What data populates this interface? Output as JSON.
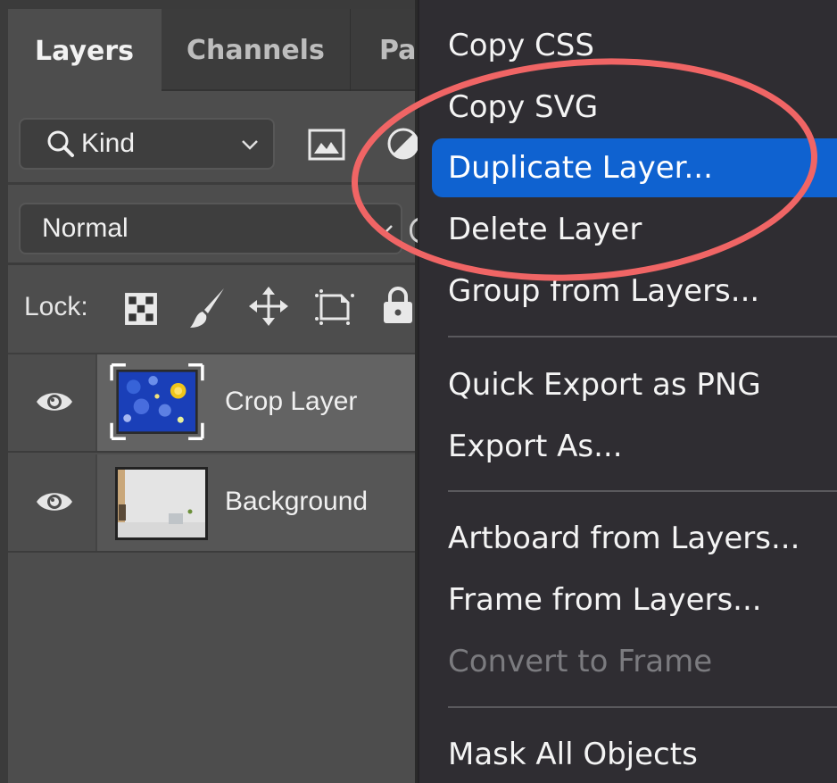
{
  "panel": {
    "tabs": [
      {
        "label": "Layers",
        "active": true
      },
      {
        "label": "Channels",
        "active": false
      },
      {
        "label": "Paths",
        "active": false,
        "visible_text": "Pa"
      }
    ],
    "filter": {
      "kind_label": "Kind",
      "icons": [
        "image-filter-icon",
        "adjustment-filter-icon"
      ]
    },
    "blend_mode": "Normal",
    "lock": {
      "label": "Lock:",
      "icons": [
        "lock-transparent-pixels-icon",
        "lock-image-pixels-icon",
        "lock-position-icon",
        "lock-artboard-icon",
        "lock-all-icon"
      ]
    },
    "layers": [
      {
        "name": "Crop Layer",
        "visible": true,
        "selected": true,
        "thumbnail": "starry-night-painting"
      },
      {
        "name": "Background",
        "visible": true,
        "selected": false,
        "thumbnail": "white-room-interior"
      }
    ]
  },
  "context_menu": {
    "groups": [
      {
        "items": [
          {
            "label": "Copy CSS",
            "enabled": true,
            "highlighted": false
          },
          {
            "label": "Copy SVG",
            "enabled": true,
            "highlighted": false
          },
          {
            "label": "Duplicate Layer...",
            "enabled": true,
            "highlighted": true
          },
          {
            "label": "Delete Layer",
            "enabled": true,
            "highlighted": false
          },
          {
            "label": "Group from Layers...",
            "enabled": true,
            "highlighted": false
          }
        ]
      },
      {
        "items": [
          {
            "label": "Quick Export as PNG",
            "enabled": true,
            "highlighted": false
          },
          {
            "label": "Export As...",
            "enabled": true,
            "highlighted": false
          }
        ]
      },
      {
        "items": [
          {
            "label": "Artboard from Layers...",
            "enabled": true,
            "highlighted": false
          },
          {
            "label": "Frame from Layers...",
            "enabled": true,
            "highlighted": false
          },
          {
            "label": "Convert to Frame",
            "enabled": false,
            "highlighted": false
          }
        ]
      },
      {
        "items": [
          {
            "label": "Mask All Objects",
            "enabled": true,
            "highlighted": false
          }
        ]
      }
    ]
  },
  "annotation": {
    "type": "ellipse",
    "color": "#f06565",
    "encircles": [
      "Copy SVG",
      "Duplicate Layer...",
      "Delete Layer"
    ]
  },
  "colors": {
    "menu_highlight": "#0f62d0",
    "panel_bg": "#4d4d4d",
    "menu_bg": "#2f2d32"
  }
}
